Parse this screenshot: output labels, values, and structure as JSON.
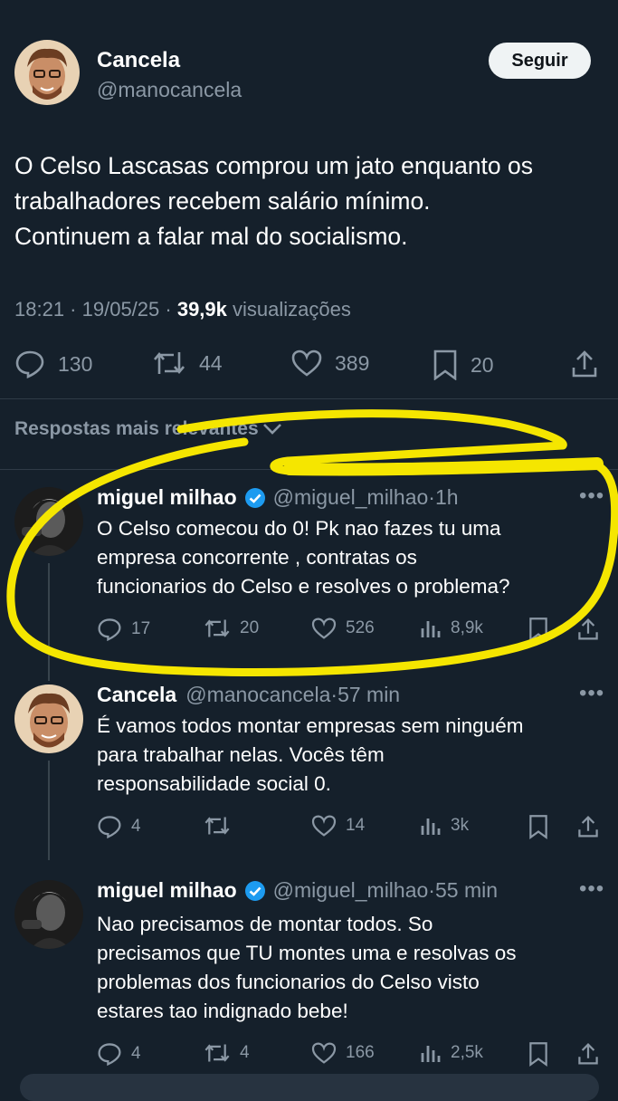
{
  "main_tweet": {
    "author_name": "Cancela",
    "author_handle": "@manocancela",
    "follow_label": "Seguir",
    "text_lines": [
      "O Celso Lascasas comprou um jato enquanto os",
      "trabalhadores recebem salário mínimo.",
      "Continuem a falar mal do socialismo."
    ],
    "time": "18:21",
    "date": "19/05/25",
    "views_count": "39,9k",
    "views_label": "visualizações",
    "replies": "130",
    "retweets": "44",
    "likes": "389",
    "bookmarks": "20"
  },
  "sort_label": "Respostas mais relevantes",
  "replies": [
    {
      "name": "miguel milhao",
      "handle": "@miguel_milhao",
      "time": "1h",
      "text_lines": [
        "O Celso comecou do 0! Pk nao fazes tu uma",
        "empresa concorrente , contratas os",
        "funcionarios do Celso e resolves o problema?"
      ],
      "replies": "17",
      "retweets": "20",
      "likes": "526",
      "views": "8,9k"
    },
    {
      "name": "Cancela",
      "handle": "@manocancela",
      "time": "57 min",
      "text_lines": [
        "É vamos todos montar empresas sem ninguém",
        "para trabalhar nelas. Vocês têm",
        "responsabilidade social 0."
      ],
      "replies": "4",
      "retweets": "",
      "likes": "14",
      "views": "3k"
    },
    {
      "name": "miguel milhao",
      "handle": "@miguel_milhao",
      "time": "55 min",
      "text_lines": [
        "Nao precisamos de montar todos. So",
        "precisamos que TU montes uma e resolvas os",
        "problemas dos funcionarios do Celso visto",
        "estares tao indignado bebe!"
      ],
      "replies": "4",
      "retweets": "4",
      "likes": "166",
      "views": "2,5k"
    }
  ],
  "colors": {
    "background": "#15202b",
    "muted_text": "#8b98a5",
    "verified": "#1d9bf0",
    "annotation": "#f5e600"
  }
}
